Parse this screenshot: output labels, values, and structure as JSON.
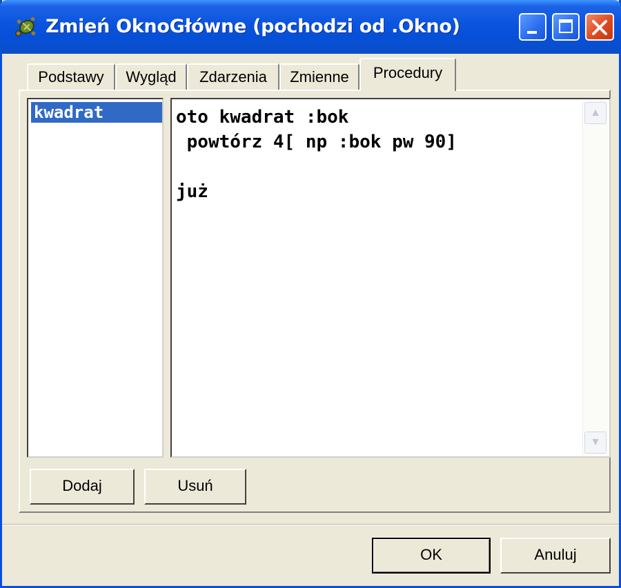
{
  "window": {
    "title": "Zmień OknoGłówne (pochodzi od .Okno)",
    "icon": "turtle-icon",
    "controls": [
      "minimize-icon",
      "maximize-icon",
      "close-icon"
    ]
  },
  "tabs": [
    {
      "label": "Podstawy",
      "active": false
    },
    {
      "label": "Wygląd",
      "active": false
    },
    {
      "label": "Zdarzenia",
      "active": false
    },
    {
      "label": "Zmienne",
      "active": false
    },
    {
      "label": "Procedury",
      "active": true
    }
  ],
  "procedures": {
    "items": [
      "kwadrat"
    ],
    "selected": "kwadrat"
  },
  "editor": {
    "content": "oto kwadrat :bok\n powtórz 4[ np :bok pw 90]\n\njuż"
  },
  "buttons": {
    "add": "Dodaj",
    "remove": "Usuń",
    "ok": "OK",
    "cancel": "Anuluj"
  },
  "colors": {
    "titlebar": "#0a54de",
    "selection": "#316ac5",
    "face": "#ece9d8",
    "close": "#dc4a20"
  }
}
